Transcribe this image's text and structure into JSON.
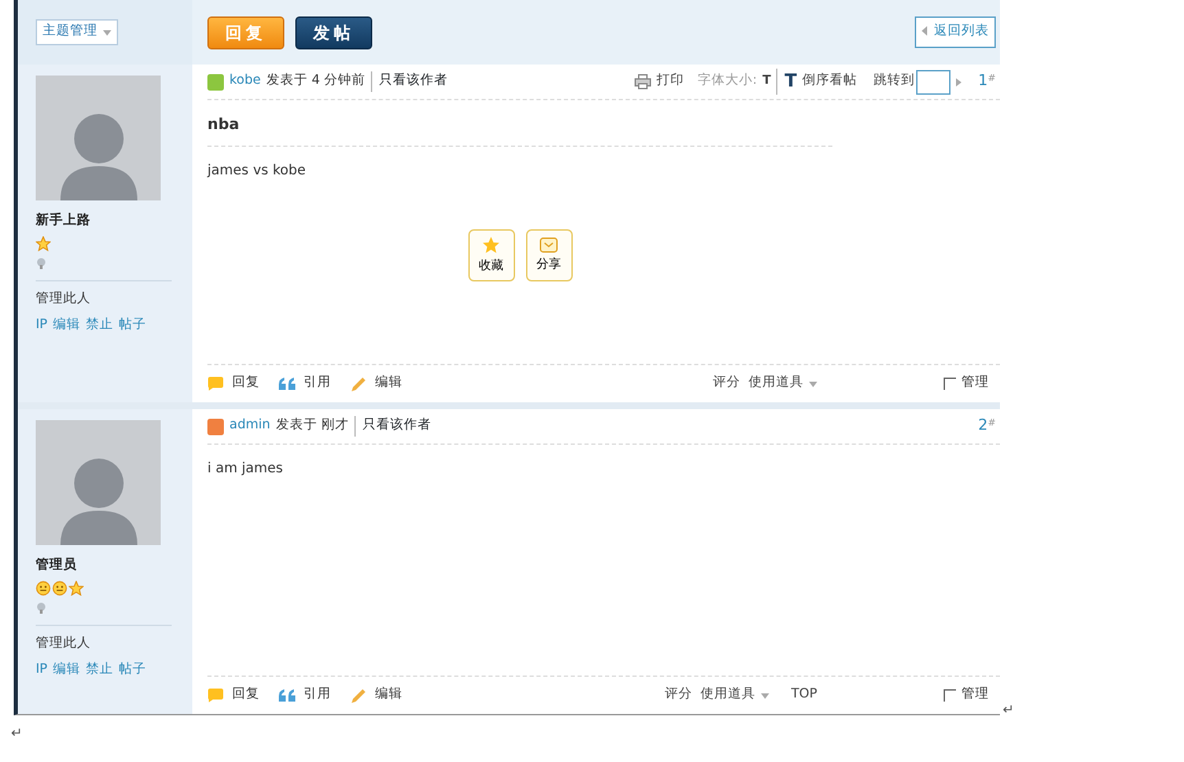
{
  "sidebar_header": {
    "dropdown": "主题管理"
  },
  "toolbar": {
    "buttons": [
      {
        "label": "回复",
        "kind": "reply"
      },
      {
        "label": "发帖",
        "kind": "post"
      }
    ],
    "back_link": "返回列表"
  },
  "posts": [
    {
      "user": {
        "rank": "新手上路",
        "rank_icons": [
          {
            "kind": "star"
          }
        ],
        "manage_label": "管理此人",
        "manage_links": [
          "IP",
          "编辑",
          "禁止",
          "帖子"
        ]
      },
      "author": "kobe",
      "color": "#8cc63f",
      "posted": "发表于 4 分钟前",
      "only_author": "只看该作者",
      "tools": {
        "print": "打印",
        "font_size": "字体大小:",
        "font_small": "T",
        "font_large": "T",
        "reverse": "倒序看帖",
        "jump": "跳转到"
      },
      "floor": "1",
      "floor_mark": "#",
      "title": "nba",
      "body": "james vs kobe",
      "actions": [
        {
          "label": "收藏",
          "kind": "favorite"
        },
        {
          "label": "分享",
          "kind": "share"
        }
      ],
      "footer": {
        "links": [
          {
            "label": "回复",
            "kind": "reply"
          },
          {
            "label": "引用",
            "kind": "quote"
          },
          {
            "label": "编辑",
            "kind": "edit"
          }
        ],
        "rate": "评分",
        "tools": "使用道具",
        "manage": "管理",
        "manage_checked": false
      }
    },
    {
      "user": {
        "rank": "管理员",
        "rank_icons": [
          {
            "kind": "sun"
          },
          {
            "kind": "sun"
          },
          {
            "kind": "star"
          }
        ],
        "manage_label": "管理此人",
        "manage_links": [
          "IP",
          "编辑",
          "禁止",
          "帖子"
        ]
      },
      "author": "admin",
      "color": "#f08040",
      "posted": "发表于 刚才",
      "only_author": "只看该作者",
      "floor": "2",
      "floor_mark": "#",
      "body": "i am james",
      "footer": {
        "links": [
          {
            "label": "回复",
            "kind": "reply"
          },
          {
            "label": "引用",
            "kind": "quote"
          },
          {
            "label": "编辑",
            "kind": "edit"
          }
        ],
        "rate": "评分",
        "tools": "使用道具",
        "top": "TOP",
        "manage": "管理",
        "manage_checked": false
      }
    }
  ],
  "paragraph_marks": [
    "↵",
    "↵"
  ]
}
